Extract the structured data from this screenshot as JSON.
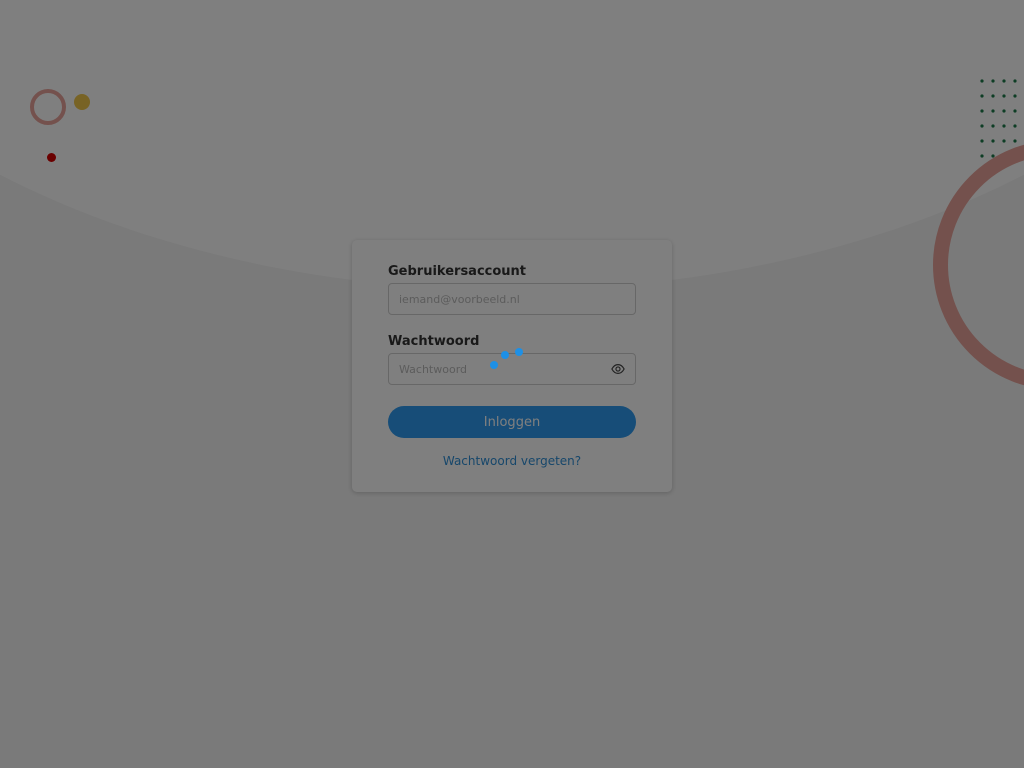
{
  "login_form": {
    "account_label": "Gebruikersaccount",
    "account_placeholder": "iemand@voorbeeld.nl",
    "account_value": "",
    "password_label": "Wachtwoord",
    "password_placeholder": "Wachtwoord",
    "password_value": "",
    "login_button_label": "Inloggen",
    "forgot_password_label": "Wachtwoord vergeten?"
  },
  "icons": {
    "password_toggle": "eye-icon",
    "loading": "loading-spinner"
  },
  "colors": {
    "primary": "#2f9bf0",
    "link": "#2f8fd6",
    "spinner": "#1e90e6",
    "accent_coral": "#e8a39a",
    "accent_yellow": "#f0c64a",
    "accent_red": "#d40000",
    "accent_green": "#1d7a4a"
  },
  "state": {
    "loading": true
  }
}
